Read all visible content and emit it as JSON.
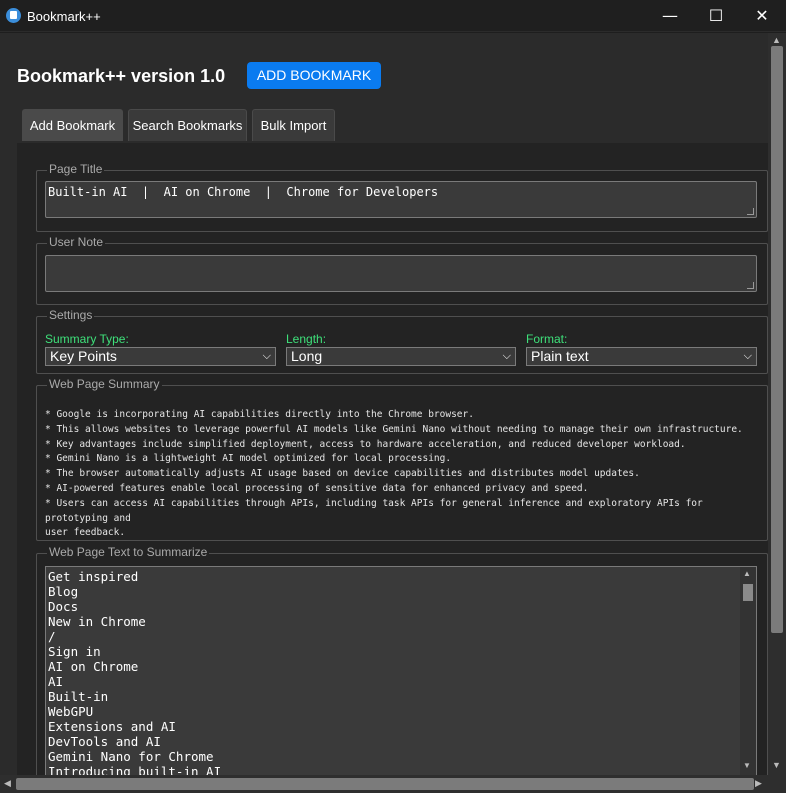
{
  "window": {
    "title": "Bookmark++",
    "min_glyph": "—",
    "max_glyph": "☐",
    "close_glyph": "✕"
  },
  "header": {
    "title": "Bookmark++ version 1.0",
    "add_button": "ADD BOOKMARK"
  },
  "tabs": [
    {
      "label": "Add Bookmark"
    },
    {
      "label": "Search Bookmarks"
    },
    {
      "label": "Bulk Import"
    }
  ],
  "page_title": {
    "legend": "Page Title",
    "value": "Built-in AI  |  AI on Chrome  |  Chrome for Developers"
  },
  "user_note": {
    "legend": "User Note",
    "value": ""
  },
  "settings": {
    "legend": "Settings",
    "summary_type": {
      "label": "Summary Type:",
      "value": "Key Points"
    },
    "length": {
      "label": "Length:",
      "value": "Long"
    },
    "format": {
      "label": "Format:",
      "value": "Plain text"
    }
  },
  "summary": {
    "legend": "Web Page Summary",
    "lines": [
      "* Google is incorporating AI capabilities directly into the Chrome browser.",
      "* This allows websites to leverage powerful AI models like Gemini Nano without needing to manage their own infrastructure.",
      "* Key advantages include simplified deployment, access to hardware acceleration, and reduced developer workload.",
      "* Gemini Nano is a lightweight AI model optimized for local processing.",
      "* The browser automatically adjusts AI usage based on device capabilities and distributes model updates.",
      "* AI-powered features enable local processing of sensitive data for enhanced privacy and speed.",
      "* Users can access AI capabilities through APIs, including task APIs for general inference and exploratory APIs for prototyping and",
      "user feedback."
    ]
  },
  "page_text": {
    "legend": "Web Page Text to Summarize",
    "lines": [
      "Get inspired",
      "Blog",
      "Docs",
      "New in Chrome",
      "/",
      "Sign in",
      "AI on Chrome",
      "AI",
      "Built-in",
      "WebGPU",
      "Extensions and AI",
      "DevTools and AI",
      "Gemini Nano for Chrome",
      "Introducing built-in AI"
    ]
  },
  "colors": {
    "accent": "#0a7bf0",
    "settings_label": "#3ee07a",
    "background": "#232323"
  }
}
